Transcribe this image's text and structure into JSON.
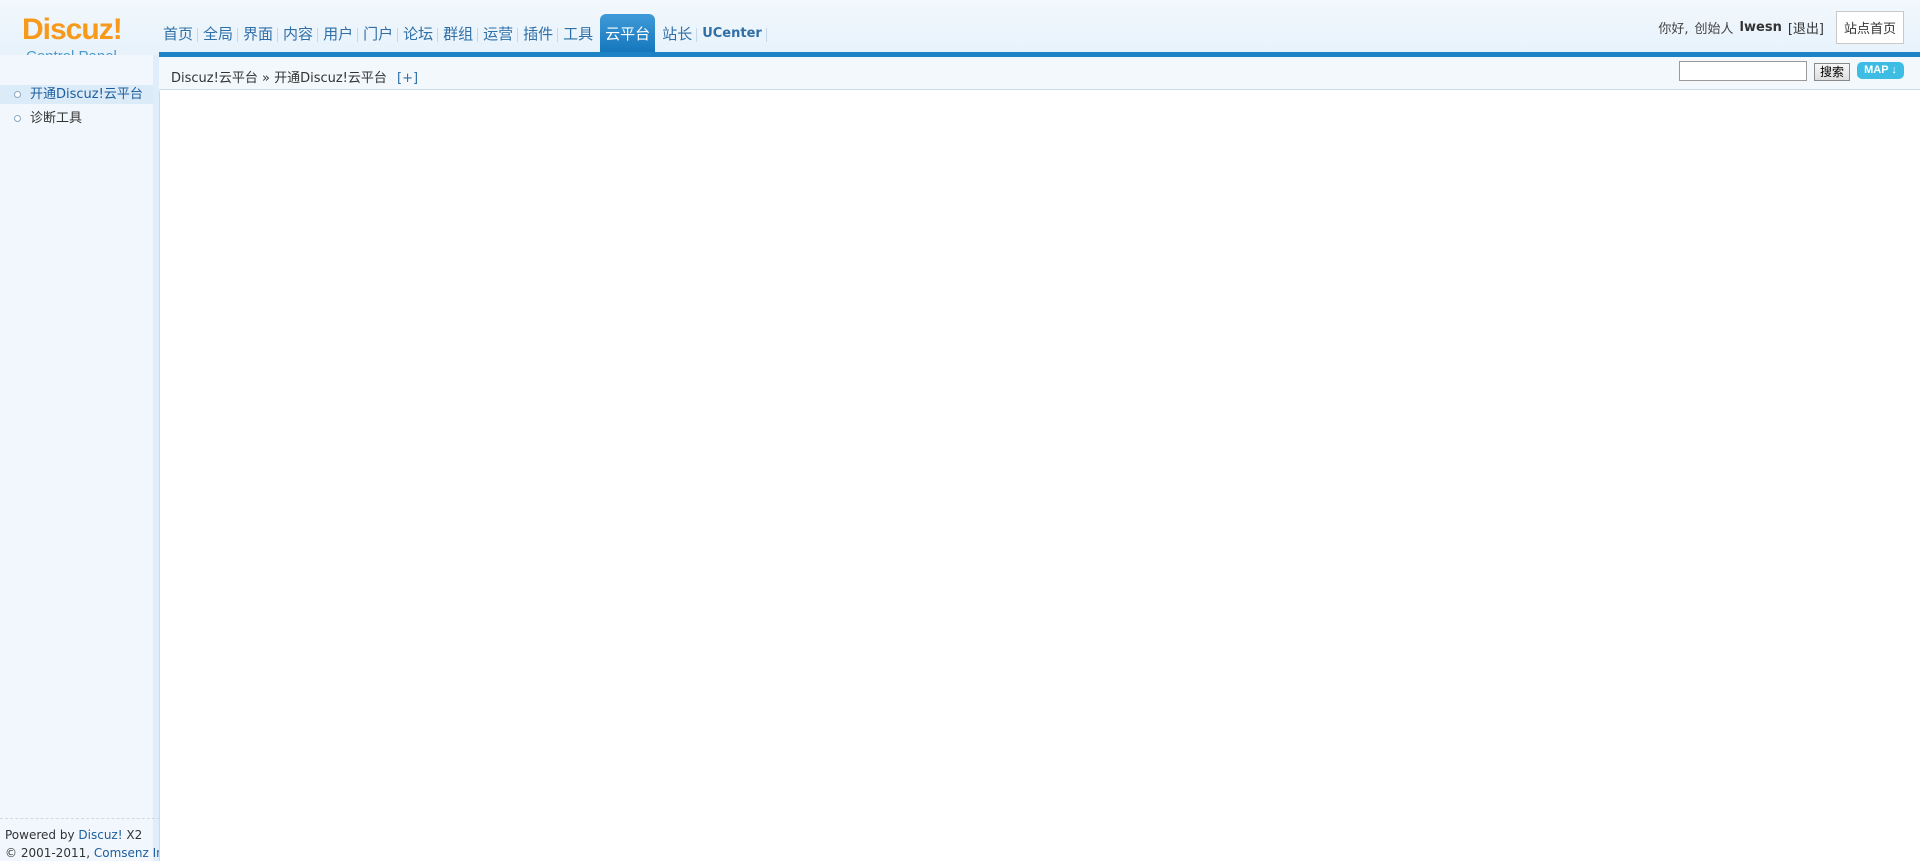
{
  "logo": {
    "main": "Discuz!",
    "sub": "Control Panel"
  },
  "nav": {
    "items": [
      {
        "label": "首页"
      },
      {
        "label": "全局"
      },
      {
        "label": "界面"
      },
      {
        "label": "内容"
      },
      {
        "label": "用户"
      },
      {
        "label": "门户"
      },
      {
        "label": "论坛"
      },
      {
        "label": "群组"
      },
      {
        "label": "运营"
      },
      {
        "label": "插件"
      },
      {
        "label": "工具"
      },
      {
        "label": "云平台"
      },
      {
        "label": "站长"
      },
      {
        "label": "UCenter"
      }
    ],
    "active_index": 11
  },
  "user": {
    "greeting": "你好,",
    "role": "创始人",
    "name": "lwesn",
    "logout": "[退出]",
    "home": "站点首页"
  },
  "sidebar": {
    "items": [
      {
        "label": "开通Discuz!云平台",
        "active": true
      },
      {
        "label": "诊断工具",
        "active": false
      }
    ],
    "footer": {
      "powered_prefix": "Powered by",
      "powered_link": "Discuz!",
      "version": "X2",
      "copyright": "© 2001-2011,",
      "company": "Comsenz Inc."
    }
  },
  "breadcrumb": {
    "root": "Discuz!云平台",
    "separator": "»",
    "current": "开通Discuz!云平台",
    "plus": "[+]"
  },
  "search": {
    "button": "搜索",
    "map": "MAP"
  }
}
